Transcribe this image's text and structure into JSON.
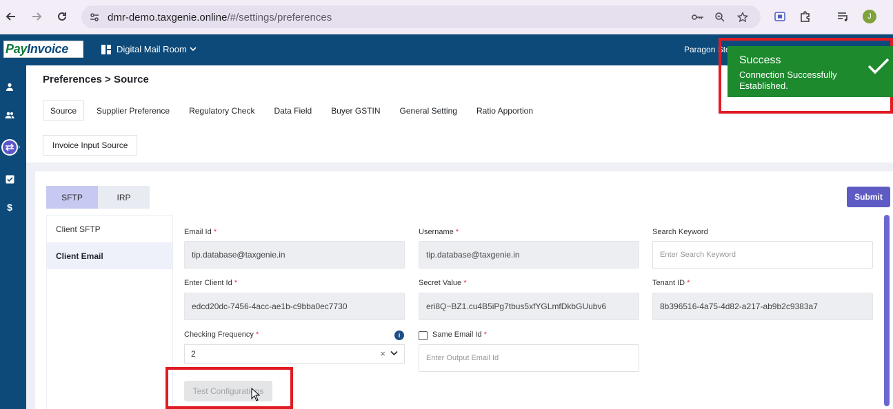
{
  "browser": {
    "url_host": "dmr-demo.taxgenie.online",
    "url_path": "/#/settings/preferences",
    "profile_initial": "J"
  },
  "header": {
    "logo_part1": "Pay",
    "logo_part2": "Invoice",
    "app_switcher": "Digital Mail Room",
    "org_name": "Paragon Ste"
  },
  "page": {
    "breadcrumb": "Preferences > Source",
    "tabs": [
      {
        "label": "Source",
        "active": true
      },
      {
        "label": "Supplier Preference",
        "active": false
      },
      {
        "label": "Regulatory Check",
        "active": false
      },
      {
        "label": "Data Field",
        "active": false
      },
      {
        "label": "Buyer GSTIN",
        "active": false
      },
      {
        "label": "General Setting",
        "active": false
      },
      {
        "label": "Ratio Apportion",
        "active": false
      }
    ],
    "sub_tab": "Invoice Input Source"
  },
  "card": {
    "modes": [
      {
        "label": "SFTP",
        "active": true
      },
      {
        "label": "IRP",
        "active": false
      }
    ],
    "submit_label": "Submit",
    "left_menu": [
      {
        "label": "Client SFTP",
        "active": false
      },
      {
        "label": "Client Email",
        "active": true
      }
    ],
    "fields": {
      "email_id": {
        "label": "Email Id",
        "value": "tip.database@taxgenie.in"
      },
      "username": {
        "label": "Username",
        "value": "tip.database@taxgenie.in"
      },
      "search_keyword": {
        "label": "Search Keyword",
        "placeholder": "Enter Search Keyword"
      },
      "client_id": {
        "label": "Enter Client Id",
        "value": "edcd20dc-7456-4acc-ae1b-c9bba0ec7730"
      },
      "secret_value": {
        "label": "Secret Value",
        "value": "eri8Q~BZ1.cu4B5iPg7tbus5xfYGLmfDkbGUubv6"
      },
      "tenant_id": {
        "label": "Tenant ID",
        "value": "8b396516-4a75-4d82-a217-ab9b2c9383a7"
      },
      "checking_frequency": {
        "label": "Checking Frequency",
        "value": "2"
      },
      "same_email": {
        "label": "Same Email Id",
        "checked": false
      },
      "output_email": {
        "placeholder": "Enter Output Email Id"
      }
    },
    "required_marker": "*",
    "test_button": "Test Configurations"
  },
  "toast": {
    "title": "Success",
    "message": "Connection Successfully Established."
  },
  "colors": {
    "brand": "#0d4a7a",
    "accent": "#5f5bc4",
    "success": "#1e8a2e",
    "highlight": "#e01b24"
  }
}
